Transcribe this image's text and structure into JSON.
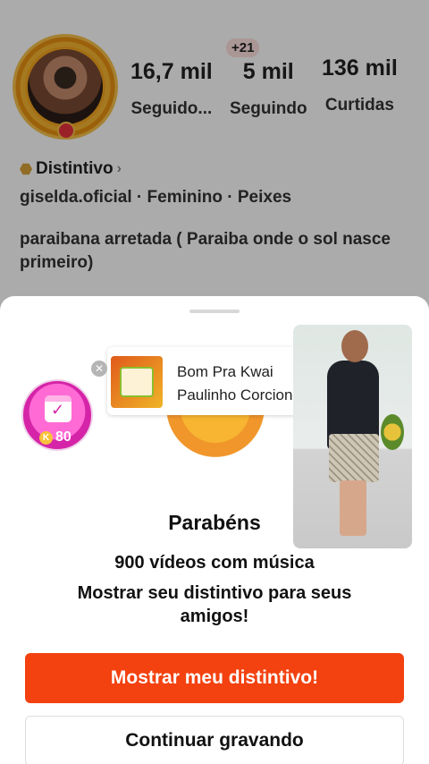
{
  "profile": {
    "stats": [
      {
        "value": "16,7 mil",
        "label": "Seguido..."
      },
      {
        "value": "5 mil",
        "label": "Seguindo",
        "badge": "+21"
      },
      {
        "value": "136 mil",
        "label": "Curtidas"
      }
    ],
    "distintivo_label": "Distintivo",
    "info_line": "giselda.oficial  ·  Feminino  ·  Peixes",
    "bio": "paraibana arretada ( Paraiba onde o sol nasce primeiro)"
  },
  "sheet": {
    "badge_coins": "80",
    "music": {
      "title": "Bom Pra Kwai",
      "artist": "Paulinho Corcione"
    },
    "title": "Parabéns",
    "subtitle": "900 vídeos com música",
    "message": "Mostrar seu distintivo para seus amigos!",
    "primary_button": "Mostrar meu distintivo!",
    "secondary_button": "Continuar gravando"
  },
  "colors": {
    "accent": "#f3410f",
    "badge_pink": "#d524a8",
    "overlay": "rgba(0,0,0,0.33)"
  }
}
